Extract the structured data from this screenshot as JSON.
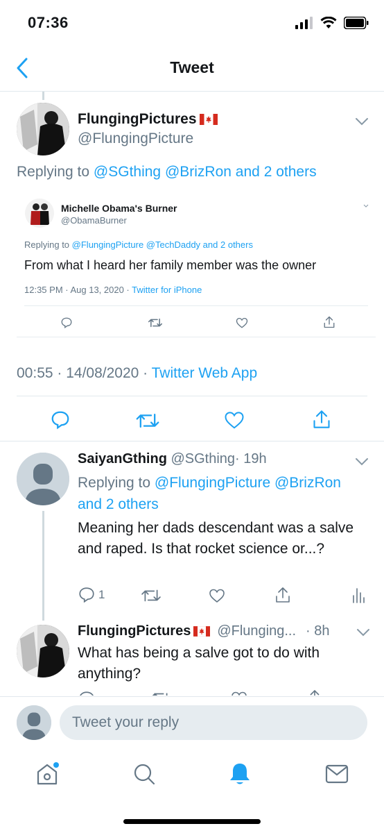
{
  "status_bar": {
    "time": "07:36"
  },
  "nav": {
    "title": "Tweet"
  },
  "main_tweet": {
    "display_name": "FlungingPictures",
    "handle": "@FlungingPicture",
    "replying_prefix": "Replying to",
    "replying_users": "@SGthing @BrizRon",
    "replying_and": "and",
    "replying_others": "2 others",
    "quoted_tweet": {
      "display_name": "Michelle Obama's Burner",
      "handle": "@ObamaBurner",
      "replying_prefix": "Replying to",
      "replying_users": "@FlungingPicture @TechDaddy",
      "replying_and": "and",
      "replying_others": "2 others",
      "text": "From what I heard her family member was the owner",
      "time": "12:35 PM · Aug 13, 2020 ·",
      "source": "Twitter for iPhone"
    },
    "time": "00:55 · 14/08/2020 ·",
    "source": "Twitter Web App"
  },
  "reply_1": {
    "display_name": "SaiyanGthing",
    "handle": "@SGthing",
    "age": "· 19h",
    "replying_prefix": "Replying to",
    "replying_users": "@FlungingPicture @BrizRon",
    "replying_and": "and",
    "replying_others": "2 others",
    "text": "Meaning her dads descendant was a salve and raped. Is that rocket science or...?",
    "reply_count": "1"
  },
  "reply_2": {
    "display_name": "FlungingPictures",
    "handle": "@Flunging...",
    "age": "· 8h",
    "text": "What has being a salve got to do with anything?"
  },
  "compose": {
    "placeholder": "Tweet your reply"
  },
  "colors": {
    "accent": "#1da1f2",
    "secondary_text": "#657786",
    "divider": "#e1e8ed"
  },
  "icons": [
    "back-chevron-icon",
    "signal-icon",
    "wifi-icon",
    "battery-icon",
    "canada-flag-icon",
    "reply-icon",
    "retweet-icon",
    "like-icon",
    "share-icon",
    "analytics-icon",
    "home-icon",
    "search-icon",
    "notifications-icon",
    "messages-icon"
  ]
}
